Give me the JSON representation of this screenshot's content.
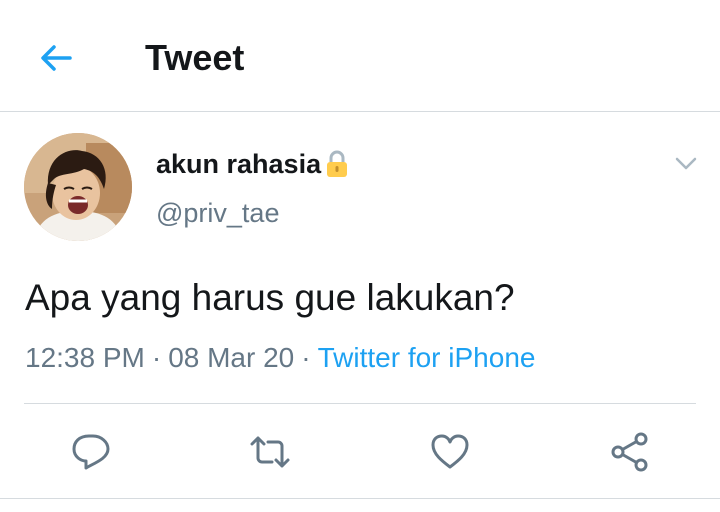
{
  "header": {
    "title": "Tweet",
    "back_icon": "arrow-left-icon"
  },
  "colors": {
    "accent": "#1da1f2",
    "secondary_text": "#657786",
    "primary_text": "#14171a",
    "divider": "#d6dbdf",
    "lock": "#ffcc4d"
  },
  "tweet": {
    "display_name": "akun rahasia",
    "name_badge": "lock-icon",
    "handle": "@priv_tae",
    "text": "Apa yang harus gue lakukan?",
    "time": "12:38 PM",
    "date": "08 Mar 20",
    "separator": "·",
    "source": "Twitter for iPhone"
  },
  "actions": [
    "reply-icon",
    "retweet-icon",
    "like-icon",
    "share-icon"
  ]
}
